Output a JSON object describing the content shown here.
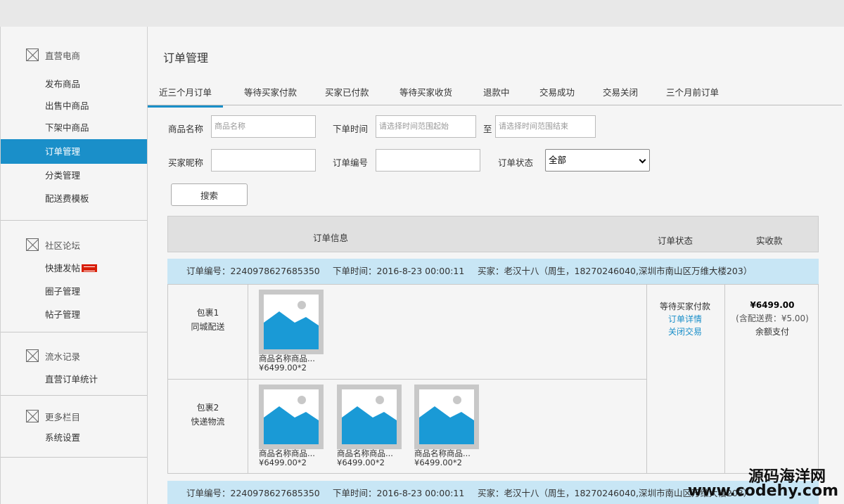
{
  "sidebar": {
    "groups": [
      {
        "title": "直营电商",
        "items": [
          "发布商品",
          "出售中商品",
          "下架中商品",
          "订单管理",
          "分类管理",
          "配送费模板"
        ]
      },
      {
        "title": "社区论坛",
        "items": [
          "快捷发帖",
          "圈子管理",
          "帖子管理"
        ]
      },
      {
        "title": "流水记录",
        "items": [
          "直营订单统计"
        ]
      },
      {
        "title": "更多栏目",
        "items": [
          "系统设置"
        ]
      }
    ],
    "active_item": "订单管理"
  },
  "main": {
    "title": "订单管理",
    "tabs": [
      "近三个月订单",
      "等待买家付款",
      "买家已付款",
      "等待买家收货",
      "退款中",
      "交易成功",
      "交易关闭",
      "三个月前订单"
    ],
    "filters": {
      "product_name_label": "商品名称",
      "product_name_placeholder": "商品名称",
      "order_time_label": "下单时间",
      "time_start_placeholder": "请选择时间范围起始",
      "to_label": "至",
      "time_end_placeholder": "请选择时间范围结束",
      "buyer_label": "买家昵称",
      "order_no_label": "订单编号",
      "status_label": "订单状态",
      "status_value": "全部",
      "search_button": "搜索"
    },
    "table": {
      "headers": [
        "订单信息",
        "订单状态",
        "实收款"
      ],
      "orders": [
        {
          "order_no": "订单编号：2240978627685350",
          "order_time": "下单时间：2016-8-23 00:00:11",
          "buyer": "买家：老汉十八（周生，18270246040,深圳市南山区万维大楼203）",
          "packages": [
            {
              "name": "包裹1",
              "method": "同城配送",
              "products": [
                {
                  "name": "商品名称商品...",
                  "price": "¥6499.00*2"
                }
              ]
            },
            {
              "name": "包裹2",
              "method": "快递物流",
              "products": [
                {
                  "name": "商品名称商品...",
                  "price": "¥6499.00*2"
                },
                {
                  "name": "商品名称商品...",
                  "price": "¥6499.00*2"
                },
                {
                  "name": "商品名称商品...",
                  "price": "¥6499.00*2"
                }
              ]
            }
          ],
          "status": "等待买家付款",
          "detail_link": "订单详情",
          "close_link": "关闭交易",
          "amount": "¥6499.00",
          "shipping": "(含配送费：¥5.00)",
          "pay_method": "余额支付"
        },
        {
          "order_no": "订单编号：2240978627685350",
          "order_time": "下单时间：2016-8-23 00:00:11",
          "buyer": "买家：老汉十八（周生，18270246040,深圳市南山区万维大楼203）"
        }
      ]
    }
  },
  "watermark": {
    "name": "源码海洋网",
    "url": "www.codehy.com"
  },
  "colors": {
    "accent": "#1a8fc9",
    "order_bar": "#c8e6f5",
    "thumb_blue": "#1a9ad6"
  }
}
